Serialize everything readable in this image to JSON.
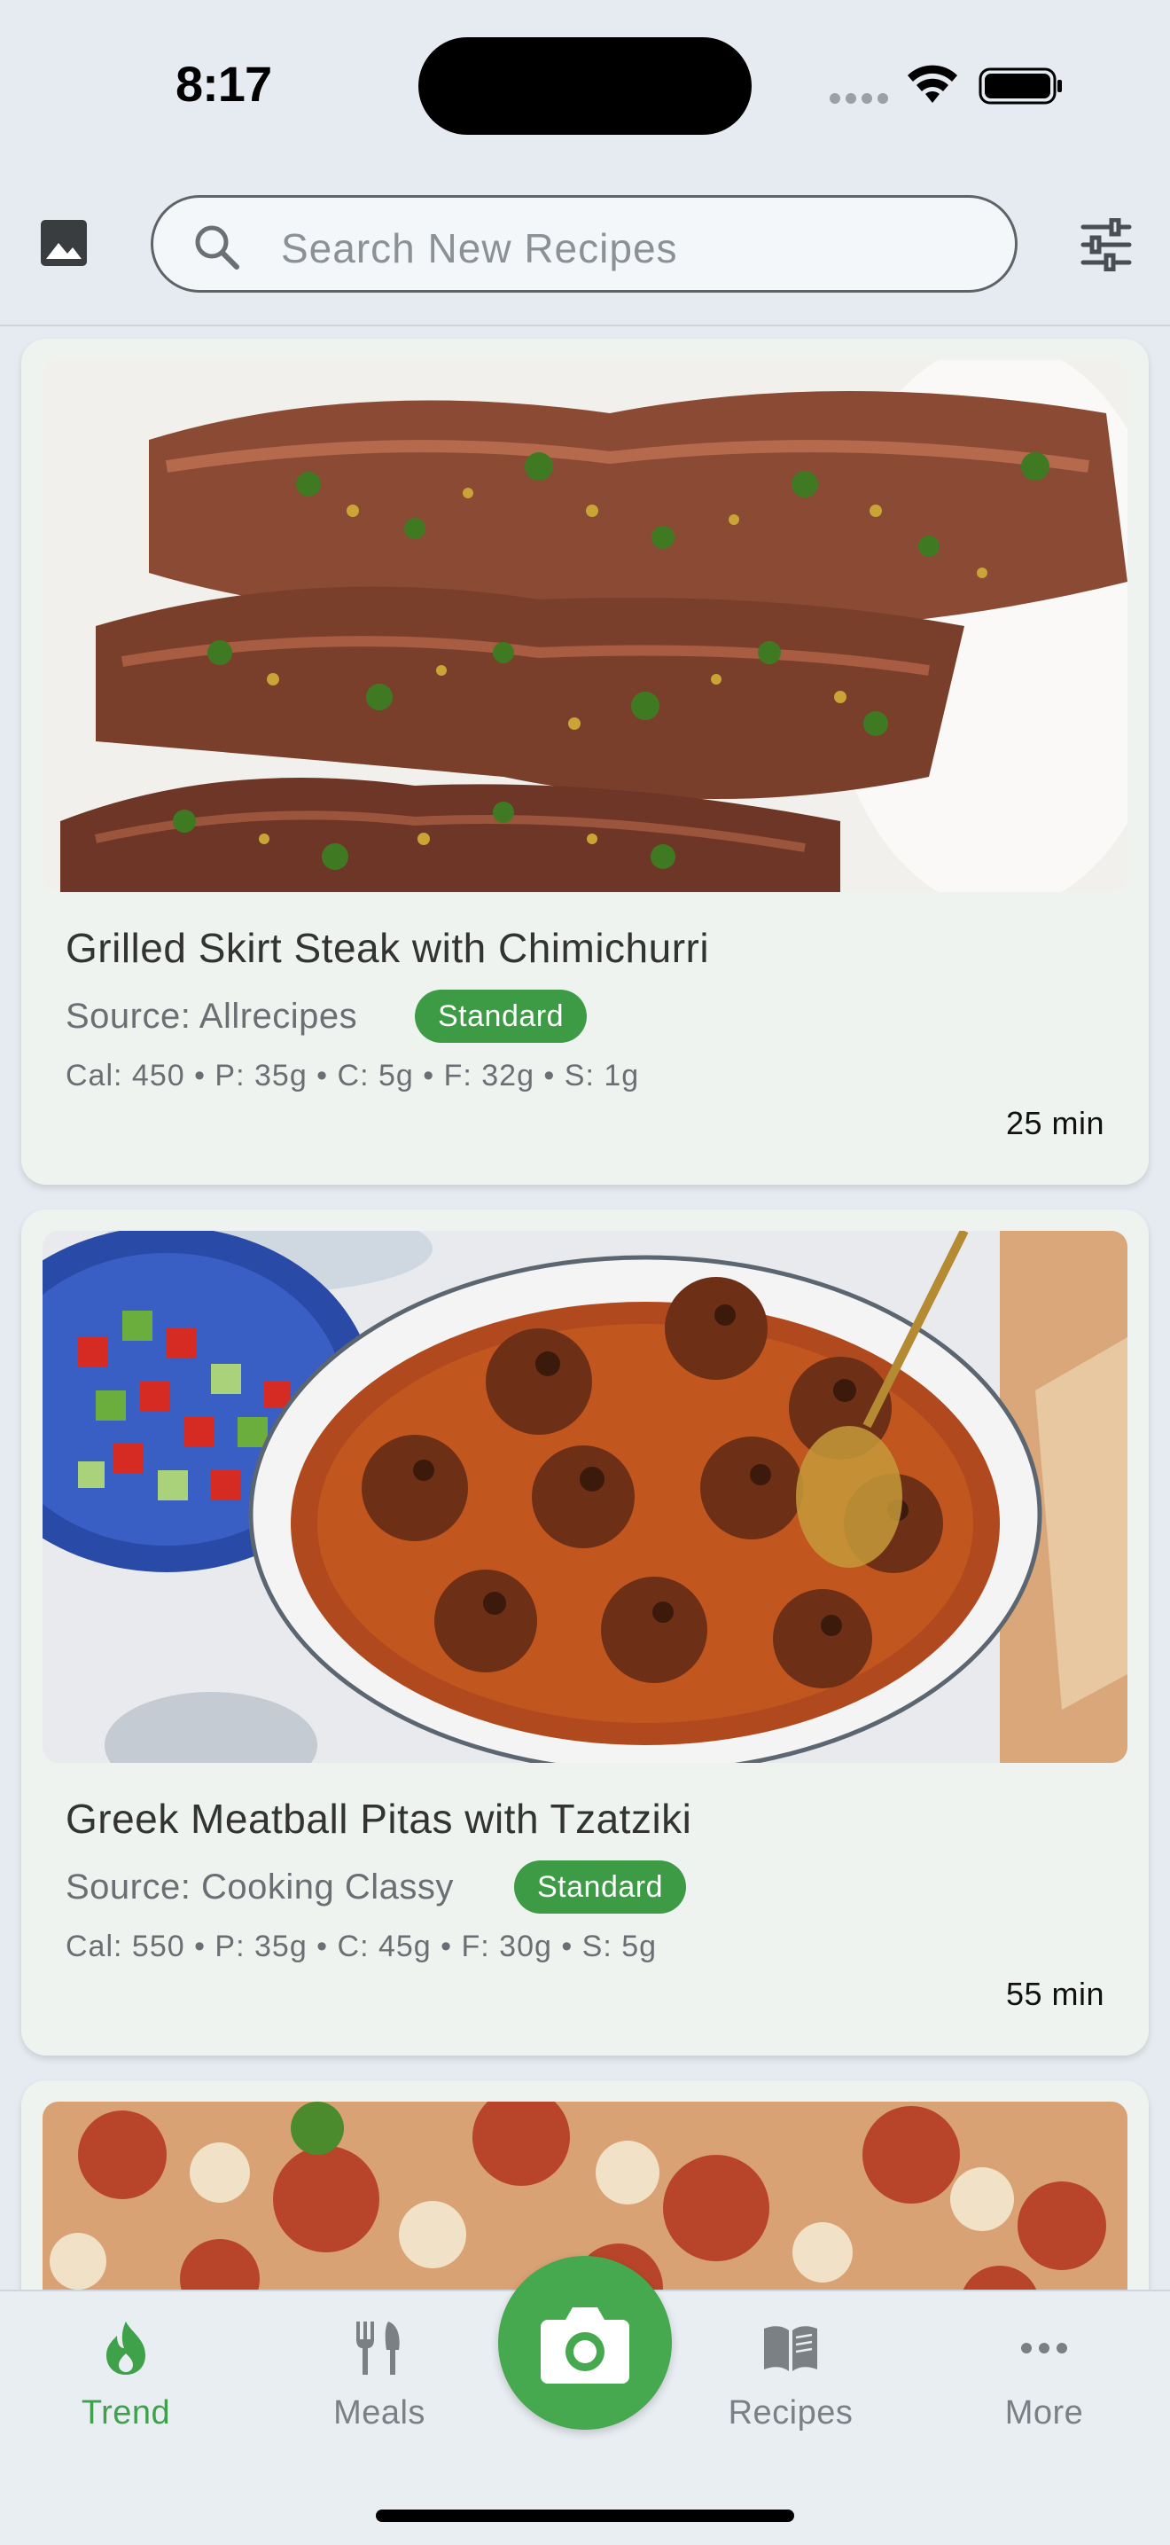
{
  "status_bar": {
    "time": "8:17"
  },
  "header": {
    "search_placeholder": "Search New Recipes"
  },
  "cards": [
    {
      "title": "Grilled Skirt Steak with Chimichurri",
      "source": "Source: Allrecipes",
      "badge": "Standard",
      "macros": "Cal: 450 • P: 35g • C: 5g • F: 32g • S: 1g",
      "time": "25 min"
    },
    {
      "title": "Greek Meatball Pitas with Tzatziki",
      "source": "Source: Cooking Classy",
      "badge": "Standard",
      "macros": "Cal: 550 • P: 35g • C: 45g • F: 30g • S: 5g",
      "time": "55 min"
    }
  ],
  "bottom_nav": {
    "items": [
      {
        "label": "Trend",
        "icon": "flame-icon",
        "active": true
      },
      {
        "label": "Meals",
        "icon": "fork-knife-icon",
        "active": false
      },
      {
        "label": "Recipes",
        "icon": "book-icon",
        "active": false
      },
      {
        "label": "More",
        "icon": "more-dots-icon",
        "active": false
      }
    ],
    "center": {
      "icon": "camera-icon"
    }
  },
  "colors": {
    "accent": "#3fa14a",
    "badge": "#3c9b44",
    "background": "#e6ebf1",
    "card": "#eff3f0"
  }
}
